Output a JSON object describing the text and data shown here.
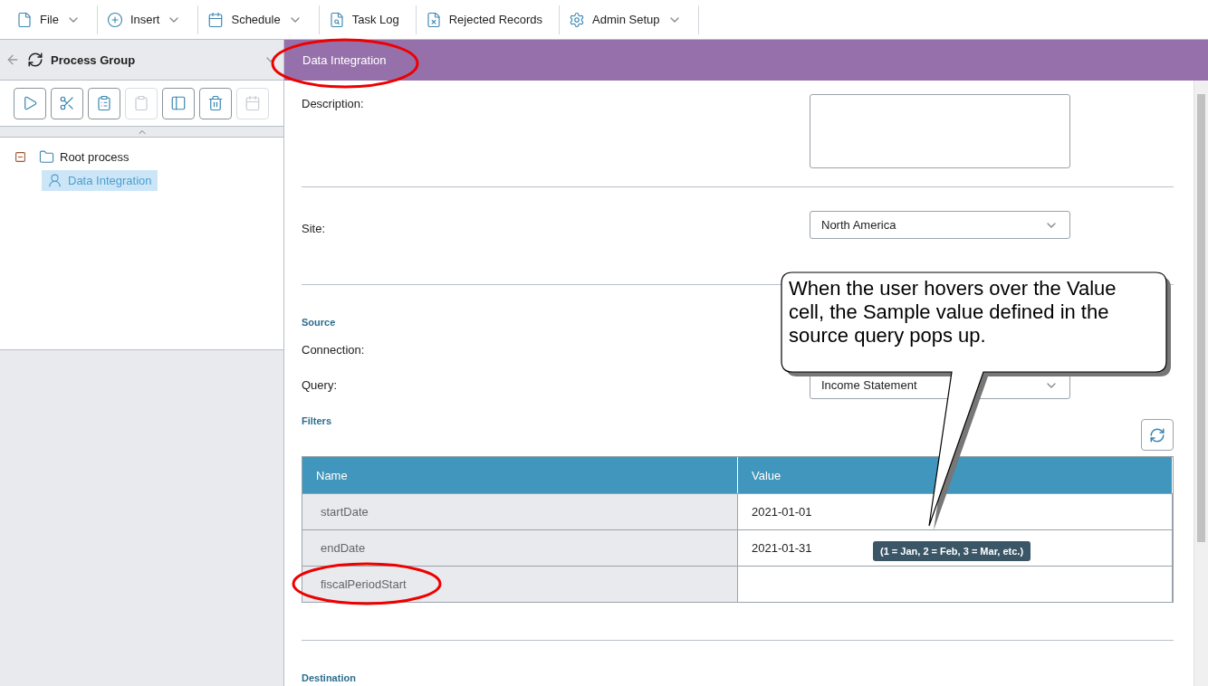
{
  "menu_bar": [
    {
      "kind": "file",
      "label": "File",
      "dropdown": true
    },
    {
      "kind": "insert",
      "label": "Insert",
      "dropdown": true
    },
    {
      "kind": "calendar",
      "label": "Schedule",
      "dropdown": true
    },
    {
      "kind": "tasklog",
      "label": "Task Log",
      "dropdown": false
    },
    {
      "kind": "rejected",
      "label": "Rejected Records",
      "dropdown": false
    },
    {
      "kind": "gear",
      "label": "Admin Setup",
      "dropdown": true
    }
  ],
  "left_panel": {
    "title": "Process Group",
    "tools": [
      {
        "kind": "run",
        "disabled": false
      },
      {
        "kind": "cut",
        "disabled": false
      },
      {
        "kind": "copy",
        "disabled": false
      },
      {
        "kind": "paste",
        "disabled": true
      },
      {
        "kind": "rename",
        "disabled": false
      },
      {
        "kind": "delete",
        "disabled": false
      },
      {
        "kind": "schedule",
        "disabled": true
      }
    ],
    "tree": [
      {
        "label": "Root process",
        "expanded": true,
        "selected": false,
        "children": [
          {
            "label": "Data Integration",
            "selected": true
          }
        ]
      }
    ]
  },
  "detail": {
    "title": "Data Integration",
    "description": {
      "label": "Description:"
    },
    "site": {
      "label": "Site:",
      "value": "North America"
    },
    "source_heading": "Source",
    "connection": {
      "label": "Connection:"
    },
    "query": {
      "label": "Query:",
      "value": "Income Statement"
    },
    "filters_heading": "Filters",
    "table": {
      "columns": [
        "Name",
        "Value"
      ],
      "rows": [
        [
          "startDate",
          "2021-01-01"
        ],
        [
          "endDate",
          "2021-01-31"
        ],
        [
          "fiscalPeriodStart",
          ""
        ]
      ]
    },
    "tooltip": "(1 = Jan, 2 = Feb, 3 = Mar, etc.)",
    "destination_heading": "Destination"
  },
  "callout": "When the user hovers over the Value cell, the Sample value defined in the source query pops up."
}
